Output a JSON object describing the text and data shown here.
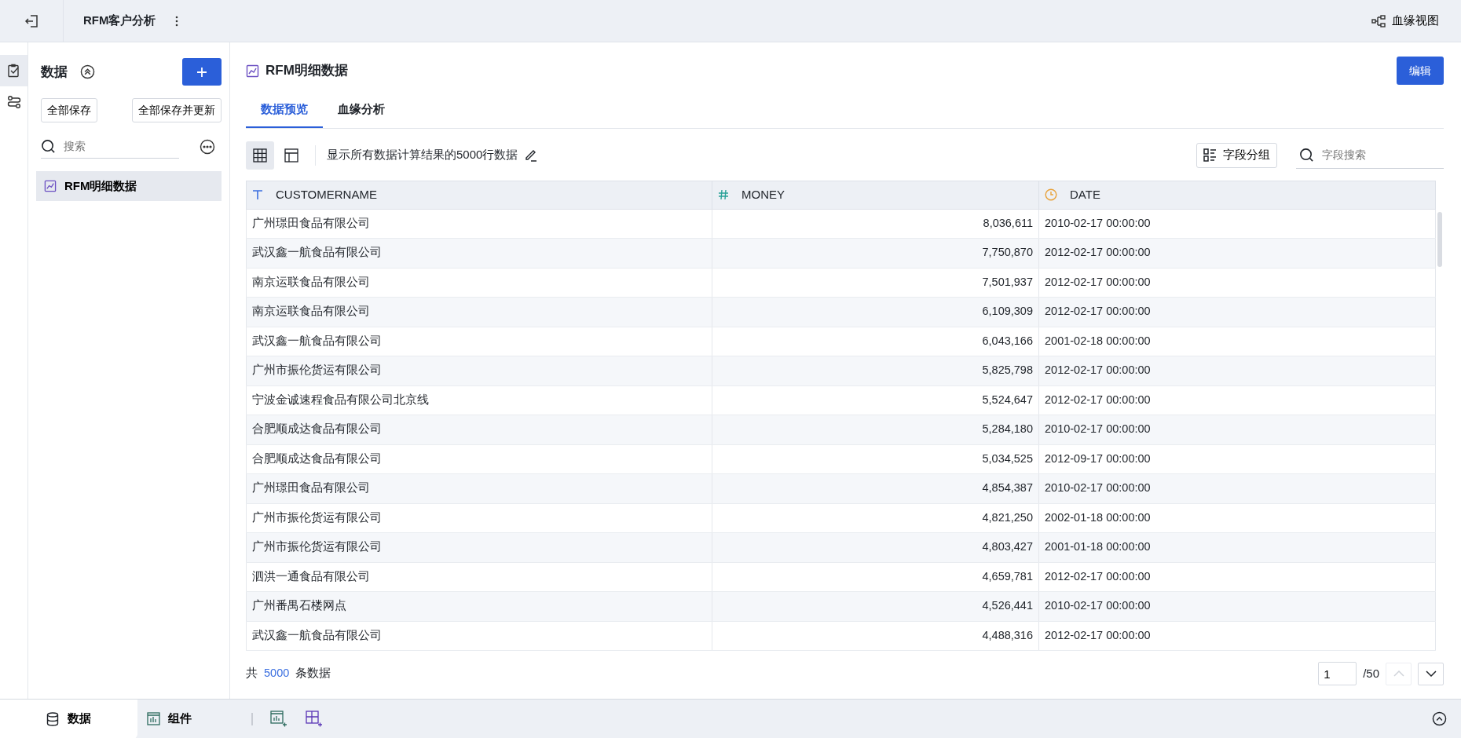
{
  "header": {
    "title": "RFM客户分析",
    "lineage_view": "血缘视图"
  },
  "rail": [
    {
      "kind": "dataset",
      "selected": true
    },
    {
      "kind": "flow",
      "selected": false
    }
  ],
  "sidebar": {
    "title": "数据",
    "buttons": [
      "全部保存",
      "全部保存并更新"
    ],
    "search": {
      "placeholder": "搜索"
    },
    "items": [
      {
        "label": "RFM明细数据",
        "selected": true
      }
    ]
  },
  "main": {
    "title": "RFM明细数据",
    "edit_button": "编辑",
    "tabs": [
      {
        "label": "数据预览",
        "selected": true
      },
      {
        "label": "血缘分析",
        "selected": false
      }
    ],
    "views": [
      {
        "kind": "grid",
        "selected": true
      },
      {
        "kind": "layout",
        "selected": false
      }
    ],
    "info": "显示所有数据计算结果的5000行数据",
    "group_button": "字段分组",
    "field_search": {
      "placeholder": "字段搜索"
    },
    "table": {
      "columns": [
        {
          "label": "CUSTOMERNAME",
          "kind": "text"
        },
        {
          "label": "MONEY",
          "kind": "number"
        },
        {
          "label": "DATE",
          "kind": "date"
        }
      ],
      "rows": [
        [
          "广州璟田食品有限公司",
          "8,036,611",
          "2010-02-17 00:00:00"
        ],
        [
          "武汉鑫一航食品有限公司",
          "7,750,870",
          "2012-02-17 00:00:00"
        ],
        [
          "南京运联食品有限公司",
          "7,501,937",
          "2012-02-17 00:00:00"
        ],
        [
          "南京运联食品有限公司",
          "6,109,309",
          "2012-02-17 00:00:00"
        ],
        [
          "武汉鑫一航食品有限公司",
          "6,043,166",
          "2001-02-18 00:00:00"
        ],
        [
          "广州市振伦货运有限公司",
          "5,825,798",
          "2012-02-17 00:00:00"
        ],
        [
          "宁波金诚速程食品有限公司北京线",
          "5,524,647",
          "2012-02-17 00:00:00"
        ],
        [
          "合肥顺成达食品有限公司",
          "5,284,180",
          "2010-02-17 00:00:00"
        ],
        [
          "合肥顺成达食品有限公司",
          "5,034,525",
          "2012-09-17 00:00:00"
        ],
        [
          "广州璟田食品有限公司",
          "4,854,387",
          "2010-02-17 00:00:00"
        ],
        [
          "广州市振伦货运有限公司",
          "4,821,250",
          "2002-01-18 00:00:00"
        ],
        [
          "广州市振伦货运有限公司",
          "4,803,427",
          "2001-01-18 00:00:00"
        ],
        [
          "泗洪一通食品有限公司",
          "4,659,781",
          "2012-02-17 00:00:00"
        ],
        [
          "广州番禺石楼网点",
          "4,526,441",
          "2010-02-17 00:00:00"
        ],
        [
          "武汉鑫一航食品有限公司",
          "4,488,316",
          "2012-02-17 00:00:00"
        ]
      ]
    },
    "footer": {
      "prefix": "共",
      "count": "5000",
      "suffix": "条数据",
      "page": "1",
      "total": "/50",
      "prev_disabled": true,
      "next_disabled": false
    }
  },
  "bottom_tabs": [
    {
      "label": "数据",
      "kind": "data",
      "selected": true
    },
    {
      "label": "组件",
      "kind": "component",
      "selected": false
    }
  ]
}
